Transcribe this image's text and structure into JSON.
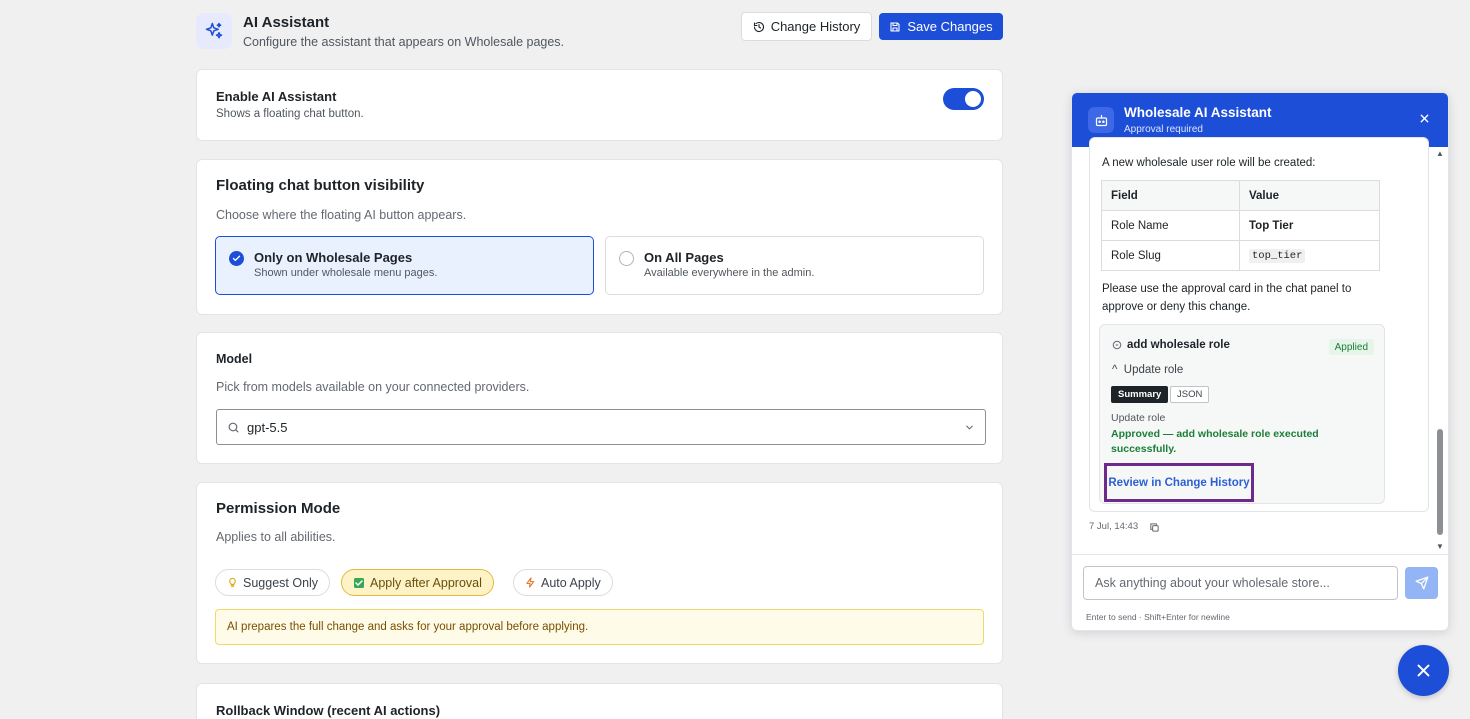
{
  "header": {
    "title": "AI Assistant",
    "subtitle": "Configure the assistant that appears on Wholesale pages.",
    "change_history_label": "Change History",
    "save_label": "Save Changes"
  },
  "enable": {
    "title": "Enable AI Assistant",
    "description": "Shows a floating chat button.",
    "enabled": true
  },
  "visibility": {
    "title": "Floating chat button visibility",
    "description": "Choose where the floating AI button appears.",
    "options": [
      {
        "label": "Only on Wholesale Pages",
        "description": "Shown under wholesale menu pages.",
        "selected": true
      },
      {
        "label": "On All Pages",
        "description": "Available everywhere in the admin.",
        "selected": false
      }
    ]
  },
  "model": {
    "title": "Model",
    "description": "Pick from models available on your connected providers.",
    "value": "gpt-5.5"
  },
  "permission": {
    "title": "Permission Mode",
    "description": "Applies to all abilities.",
    "options": [
      {
        "label": "Suggest Only",
        "icon": "lightbulb-icon"
      },
      {
        "label": "Apply after Approval",
        "icon": "checkbox-icon",
        "selected": true
      },
      {
        "label": "Auto Apply",
        "icon": "bolt-icon"
      }
    ],
    "notice": "AI prepares the full change and asks for your approval before applying."
  },
  "rollback": {
    "title": "Rollback Window (recent AI actions)"
  },
  "chat": {
    "title": "Wholesale AI Assistant",
    "subtitle": "Approval required",
    "message": {
      "intro": "A new wholesale user role will be created:",
      "table": {
        "headers": [
          "Field",
          "Value"
        ],
        "rows": [
          {
            "field": "Role Name",
            "value": "Top Tier"
          },
          {
            "field": "Role Slug",
            "value": "top_tier"
          }
        ]
      },
      "note": "Please use the approval card in the chat panel to approve or deny this change.",
      "approval": {
        "title": "add wholesale role",
        "badge": "Applied",
        "toggle_label": "Update role",
        "tab_summary": "Summary",
        "tab_json": "JSON",
        "sub_label": "Update role",
        "result": "Approved — add wholesale role executed successfully.",
        "link": "Review in Change History"
      },
      "timestamp": "7 Jul, 14:43"
    },
    "input_placeholder": "Ask anything about your wholesale store...",
    "hint": "Enter to send · Shift+Enter for newline"
  },
  "colors": {
    "primary": "#1d4ed8",
    "success": "#1a7f37",
    "warning_bg": "#fefbe8",
    "highlight_border": "#6b2a8c"
  }
}
